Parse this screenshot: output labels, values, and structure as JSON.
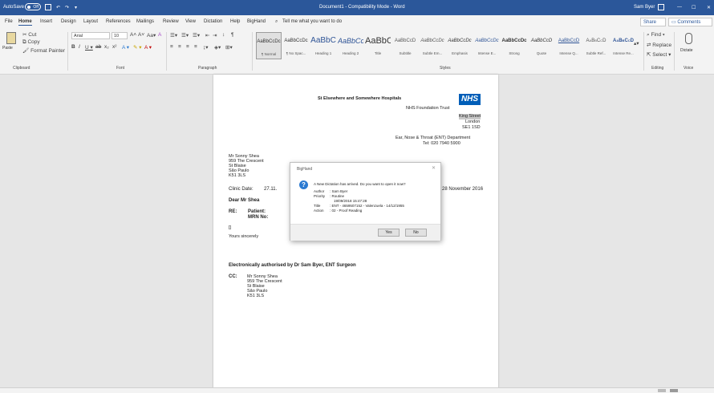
{
  "titlebar": {
    "autosave": "AutoSave",
    "autosave_state": "Off",
    "document_title": "Document1  -  Compatibility Mode  -  Word",
    "user": "Sam Byer"
  },
  "tabs": [
    "File",
    "Home",
    "Insert",
    "Design",
    "Layout",
    "References",
    "Mailings",
    "Review",
    "View",
    "Dictation",
    "Help",
    "BigHand"
  ],
  "tell_me": "Tell me what you want to do",
  "share": "Share",
  "comments": "Comments",
  "clipboard": {
    "paste": "Paste",
    "cut": "Cut",
    "copy": "Copy",
    "format_painter": "Format Painter",
    "label": "Clipboard"
  },
  "font": {
    "name": "Arial",
    "size": "10",
    "label": "Font"
  },
  "paragraph": {
    "label": "Paragraph"
  },
  "styles": {
    "label": "Styles",
    "items": [
      {
        "sample": "AaBbCcDc",
        "name": "¶ Normal"
      },
      {
        "sample": "AaBbCcDc",
        "name": "¶ No Spac..."
      },
      {
        "sample": "AaBbC",
        "name": "Heading 1"
      },
      {
        "sample": "AaBbCc",
        "name": "Heading 2"
      },
      {
        "sample": "AaBbC",
        "name": "Title"
      },
      {
        "sample": "AaBbCcD",
        "name": "Subtitle"
      },
      {
        "sample": "AaBbCcDc",
        "name": "Subtle Em..."
      },
      {
        "sample": "AaBbCcDc",
        "name": "Emphasis"
      },
      {
        "sample": "AaBbCcDc",
        "name": "Intense E..."
      },
      {
        "sample": "AaBbCcDc",
        "name": "Strong"
      },
      {
        "sample": "AaBbCcD",
        "name": "Quote"
      },
      {
        "sample": "AaBbCcD",
        "name": "Intense Q..."
      },
      {
        "sample": "AaBbCcD",
        "name": "Subtle Ref..."
      },
      {
        "sample": "AaBbCcD",
        "name": "Intense Re..."
      }
    ]
  },
  "editing": {
    "find": "Find",
    "replace": "Replace",
    "select": "Select",
    "label": "Editing"
  },
  "voice": {
    "dictate": "Dictate",
    "label": "Voice"
  },
  "letter": {
    "hospital": "St Elsewhere and Somewhere Hospitals",
    "nhs": "NHS",
    "trust": "NHS Foundation Trust",
    "address": [
      "King Street",
      "London",
      "SE1 1SD"
    ],
    "department": "Ear, Nose & Throat (ENT) Department",
    "tel": "Tel: 020 7940 5900",
    "recipient": [
      "Mr Sonny Shea",
      "959 The Crescent",
      "St Blaise",
      "São Paulo",
      "K51 3LS"
    ],
    "clinic_date_label": "Clinic Date:",
    "clinic_date_value": "27.11.",
    "letter_date": "28 November 2016",
    "salutation": "Dear Mr Shea",
    "re_label": "RE:",
    "patient_label": "Patient:",
    "mrn_label": "MRN No:",
    "field_marker": "[]",
    "closing": "Yours sincerely",
    "authorised": "Electronically authorised by Dr Sam Byer, ENT Surgeon",
    "cc_label": "CC:",
    "cc": [
      "Mr Sonny Shea",
      "959 The Crescent",
      "St Blaise",
      "São Paulo",
      "K51 3LS"
    ]
  },
  "dialog": {
    "title": "BigHand",
    "message": "A New Dictation has arrived. Do you want to open it now?",
    "fields": [
      {
        "label": "Author",
        "value": ": Sam Byer"
      },
      {
        "label": "Priority",
        "value": ": Routine"
      },
      {
        "label": "",
        "value": "19/09/2018 15:47:28"
      },
      {
        "label": "Title",
        "value": ": ENT - 4659507152 - Valenzuela - 14/12/1955"
      },
      {
        "label": "Action",
        "value": ": 02 - Proof Reading"
      }
    ],
    "yes": "Yes",
    "no": "No"
  }
}
